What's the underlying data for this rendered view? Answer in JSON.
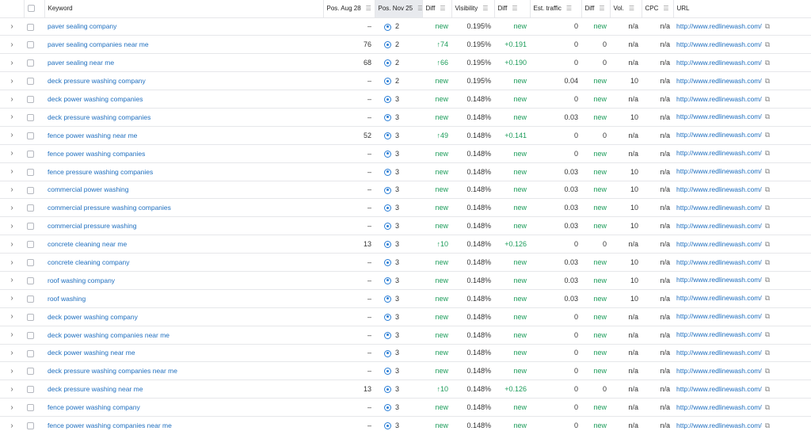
{
  "headers": {
    "keyword": "Keyword",
    "pos_aug": "Pos. Aug 28",
    "pos_nov": "Pos. Nov 25",
    "diff1": "Diff",
    "visibility": "Visibility",
    "diff2": "Diff",
    "est_traffic": "Est. traffic",
    "diff3": "Diff",
    "vol": "Vol.",
    "cpc": "CPC",
    "url": "URL"
  },
  "rows": [
    {
      "keyword": "paver sealing company",
      "pos_aug": "–",
      "pos_nov": "2",
      "diff": "new",
      "visibility": "0.195%",
      "vis_diff": "new",
      "traffic": "0",
      "traffic_diff": "new",
      "vol": "n/a",
      "cpc": "n/a",
      "url": "http://www.redlinewash.com/"
    },
    {
      "keyword": "paver sealing companies near me",
      "pos_aug": "76",
      "pos_nov": "2",
      "diff": "↑74",
      "visibility": "0.195%",
      "vis_diff": "+0.191",
      "traffic": "0",
      "traffic_diff": "0",
      "vol": "n/a",
      "cpc": "n/a",
      "url": "http://www.redlinewash.com/"
    },
    {
      "keyword": "paver sealing near me",
      "pos_aug": "68",
      "pos_nov": "2",
      "diff": "↑66",
      "visibility": "0.195%",
      "vis_diff": "+0.190",
      "traffic": "0",
      "traffic_diff": "0",
      "vol": "n/a",
      "cpc": "n/a",
      "url": "http://www.redlinewash.com/"
    },
    {
      "keyword": "deck pressure washing company",
      "pos_aug": "–",
      "pos_nov": "2",
      "diff": "new",
      "visibility": "0.195%",
      "vis_diff": "new",
      "traffic": "0.04",
      "traffic_diff": "new",
      "vol": "10",
      "cpc": "n/a",
      "url": "http://www.redlinewash.com/"
    },
    {
      "keyword": "deck power washing companies",
      "pos_aug": "–",
      "pos_nov": "3",
      "diff": "new",
      "visibility": "0.148%",
      "vis_diff": "new",
      "traffic": "0",
      "traffic_diff": "new",
      "vol": "n/a",
      "cpc": "n/a",
      "url": "http://www.redlinewash.com/"
    },
    {
      "keyword": "deck pressure washing companies",
      "pos_aug": "–",
      "pos_nov": "3",
      "diff": "new",
      "visibility": "0.148%",
      "vis_diff": "new",
      "traffic": "0.03",
      "traffic_diff": "new",
      "vol": "10",
      "cpc": "n/a",
      "url": "http://www.redlinewash.com/"
    },
    {
      "keyword": "fence power washing near me",
      "pos_aug": "52",
      "pos_nov": "3",
      "diff": "↑49",
      "visibility": "0.148%",
      "vis_diff": "+0.141",
      "traffic": "0",
      "traffic_diff": "0",
      "vol": "n/a",
      "cpc": "n/a",
      "url": "http://www.redlinewash.com/"
    },
    {
      "keyword": "fence power washing companies",
      "pos_aug": "–",
      "pos_nov": "3",
      "diff": "new",
      "visibility": "0.148%",
      "vis_diff": "new",
      "traffic": "0",
      "traffic_diff": "new",
      "vol": "n/a",
      "cpc": "n/a",
      "url": "http://www.redlinewash.com/"
    },
    {
      "keyword": "fence pressure washing companies",
      "pos_aug": "–",
      "pos_nov": "3",
      "diff": "new",
      "visibility": "0.148%",
      "vis_diff": "new",
      "traffic": "0.03",
      "traffic_diff": "new",
      "vol": "10",
      "cpc": "n/a",
      "url": "http://www.redlinewash.com/"
    },
    {
      "keyword": "commercial power washing",
      "pos_aug": "–",
      "pos_nov": "3",
      "diff": "new",
      "visibility": "0.148%",
      "vis_diff": "new",
      "traffic": "0.03",
      "traffic_diff": "new",
      "vol": "10",
      "cpc": "n/a",
      "url": "http://www.redlinewash.com/"
    },
    {
      "keyword": "commercial pressure washing companies",
      "pos_aug": "–",
      "pos_nov": "3",
      "diff": "new",
      "visibility": "0.148%",
      "vis_diff": "new",
      "traffic": "0.03",
      "traffic_diff": "new",
      "vol": "10",
      "cpc": "n/a",
      "url": "http://www.redlinewash.com/"
    },
    {
      "keyword": "commercial pressure washing",
      "pos_aug": "–",
      "pos_nov": "3",
      "diff": "new",
      "visibility": "0.148%",
      "vis_diff": "new",
      "traffic": "0.03",
      "traffic_diff": "new",
      "vol": "10",
      "cpc": "n/a",
      "url": "http://www.redlinewash.com/"
    },
    {
      "keyword": "concrete cleaning near me",
      "pos_aug": "13",
      "pos_nov": "3",
      "diff": "↑10",
      "visibility": "0.148%",
      "vis_diff": "+0.126",
      "traffic": "0",
      "traffic_diff": "0",
      "vol": "n/a",
      "cpc": "n/a",
      "url": "http://www.redlinewash.com/"
    },
    {
      "keyword": "concrete cleaning company",
      "pos_aug": "–",
      "pos_nov": "3",
      "diff": "new",
      "visibility": "0.148%",
      "vis_diff": "new",
      "traffic": "0.03",
      "traffic_diff": "new",
      "vol": "10",
      "cpc": "n/a",
      "url": "http://www.redlinewash.com/"
    },
    {
      "keyword": "roof washing company",
      "pos_aug": "–",
      "pos_nov": "3",
      "diff": "new",
      "visibility": "0.148%",
      "vis_diff": "new",
      "traffic": "0.03",
      "traffic_diff": "new",
      "vol": "10",
      "cpc": "n/a",
      "url": "http://www.redlinewash.com/"
    },
    {
      "keyword": "roof washing",
      "pos_aug": "–",
      "pos_nov": "3",
      "diff": "new",
      "visibility": "0.148%",
      "vis_diff": "new",
      "traffic": "0.03",
      "traffic_diff": "new",
      "vol": "10",
      "cpc": "n/a",
      "url": "http://www.redlinewash.com/"
    },
    {
      "keyword": "deck power washing company",
      "pos_aug": "–",
      "pos_nov": "3",
      "diff": "new",
      "visibility": "0.148%",
      "vis_diff": "new",
      "traffic": "0",
      "traffic_diff": "new",
      "vol": "n/a",
      "cpc": "n/a",
      "url": "http://www.redlinewash.com/"
    },
    {
      "keyword": "deck power washing companies near me",
      "pos_aug": "–",
      "pos_nov": "3",
      "diff": "new",
      "visibility": "0.148%",
      "vis_diff": "new",
      "traffic": "0",
      "traffic_diff": "new",
      "vol": "n/a",
      "cpc": "n/a",
      "url": "http://www.redlinewash.com/"
    },
    {
      "keyword": "deck power washing near me",
      "pos_aug": "–",
      "pos_nov": "3",
      "diff": "new",
      "visibility": "0.148%",
      "vis_diff": "new",
      "traffic": "0",
      "traffic_diff": "new",
      "vol": "n/a",
      "cpc": "n/a",
      "url": "http://www.redlinewash.com/"
    },
    {
      "keyword": "deck pressure washing companies near me",
      "pos_aug": "–",
      "pos_nov": "3",
      "diff": "new",
      "visibility": "0.148%",
      "vis_diff": "new",
      "traffic": "0",
      "traffic_diff": "new",
      "vol": "n/a",
      "cpc": "n/a",
      "url": "http://www.redlinewash.com/"
    },
    {
      "keyword": "deck pressure washing near me",
      "pos_aug": "13",
      "pos_nov": "3",
      "diff": "↑10",
      "visibility": "0.148%",
      "vis_diff": "+0.126",
      "traffic": "0",
      "traffic_diff": "0",
      "vol": "n/a",
      "cpc": "n/a",
      "url": "http://www.redlinewash.com/"
    },
    {
      "keyword": "fence power washing company",
      "pos_aug": "–",
      "pos_nov": "3",
      "diff": "new",
      "visibility": "0.148%",
      "vis_diff": "new",
      "traffic": "0",
      "traffic_diff": "new",
      "vol": "n/a",
      "cpc": "n/a",
      "url": "http://www.redlinewash.com/"
    },
    {
      "keyword": "fence power washing companies near me",
      "pos_aug": "–",
      "pos_nov": "3",
      "diff": "new",
      "visibility": "0.148%",
      "vis_diff": "new",
      "traffic": "0",
      "traffic_diff": "new",
      "vol": "n/a",
      "cpc": "n/a",
      "url": "http://www.redlinewash.com/"
    }
  ],
  "colors": {
    "link": "#1f6fbf",
    "positive": "#1c9c5a",
    "sorted_header_bg": "#e8eaee"
  },
  "icons": {
    "expand": "chevron-right-icon",
    "position": "location-pin-icon",
    "url_link": "external-link-icon",
    "sort": "sort-icon"
  }
}
